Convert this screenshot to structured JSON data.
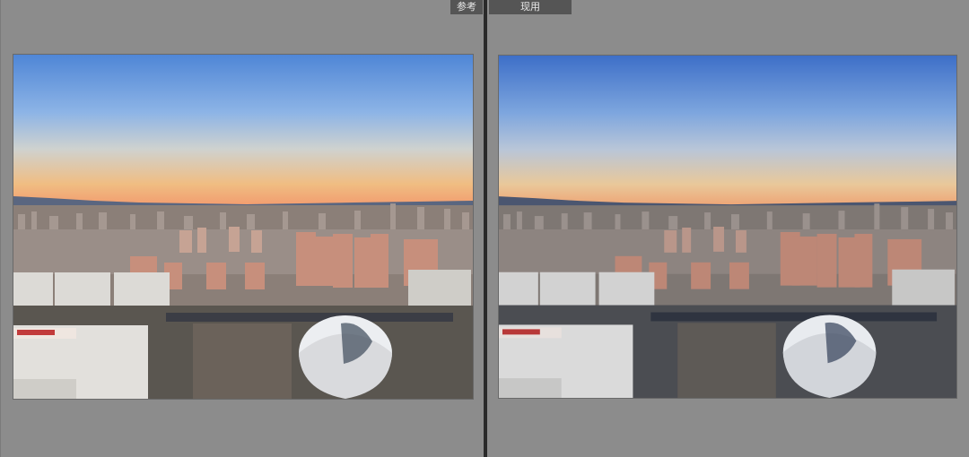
{
  "panels": {
    "reference": {
      "label": "参考"
    },
    "current": {
      "label": "现用"
    }
  },
  "colors": {
    "panel_bg": "#8c8c8c",
    "divider": "#2a2a2a",
    "tab_bg": "#555555"
  },
  "photos": [
    {
      "sky": [
        "#4f86d6",
        "#8db4e6",
        "#cfd2cf",
        "#f0bd82",
        "#f29a6e"
      ],
      "buildings": "#b89383",
      "ground": "#5a5650"
    },
    {
      "sky": [
        "#3d6fc8",
        "#7ea6de",
        "#b9c6d8",
        "#e9c89a",
        "#eea273"
      ],
      "buildings": "#a98a80",
      "ground": "#4b4d52"
    }
  ]
}
